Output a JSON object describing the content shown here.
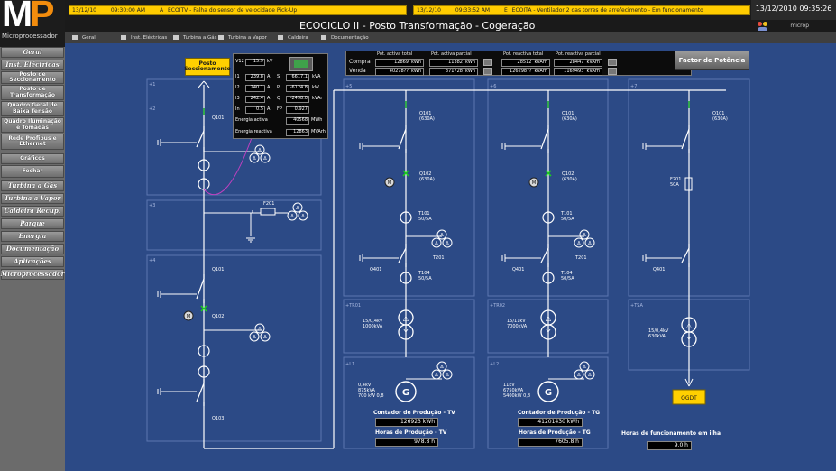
{
  "brand": {
    "logo_m": "M",
    "logo_p": "P",
    "logo_sub": "Microprocessador"
  },
  "alarms": [
    {
      "date": "13/12/10",
      "time": "09:30:00 AM",
      "state": "A",
      "text": "ECOITV - Falha do sensor de velocidade Pick-Up"
    },
    {
      "date": "13/12/10",
      "time": "09:33:52 AM",
      "state": "E",
      "text": "ECOITA - Ventilador 2 das torres de arrefecimento - Em funcionamento"
    }
  ],
  "datetime": "13/12/2010 09:35:26",
  "user": "microp",
  "title": "ECOCICLO II - Posto Transformação - Cogeração",
  "tabs": [
    "Geral",
    "Inst. Eléctricas",
    "Turbina a Gás",
    "Turbina a Vapor",
    "Caldeira",
    "Documentação"
  ],
  "sidebar": [
    {
      "label": "Geral",
      "style": "it"
    },
    {
      "label": "Inst. Eléctricas",
      "style": "it"
    },
    {
      "label": "Posto de Seccionamento",
      "style": ""
    },
    {
      "label": "Posto de Transformação",
      "style": ""
    },
    {
      "label": "Quadro Geral de Baixa Tensão",
      "style": ""
    },
    {
      "label": "Quadro Iluminação e Tomadas",
      "style": ""
    },
    {
      "label": "Rede Profibus e Ethernet",
      "style": ""
    },
    {
      "label": "Gráficos",
      "style": ""
    },
    {
      "label": "Fechar",
      "style": ""
    },
    {
      "label": "Turbina a Gás",
      "style": "it"
    },
    {
      "label": "Turbina a Vapor",
      "style": "it"
    },
    {
      "label": "Caldeira Recup.",
      "style": "it"
    },
    {
      "label": "Parque",
      "style": "it"
    },
    {
      "label": "Energia",
      "style": "it"
    },
    {
      "label": "Documentação",
      "style": "it"
    },
    {
      "label": "Aplicações",
      "style": "it"
    },
    {
      "label": "Microprocessador",
      "style": "it"
    }
  ],
  "posto_seccionamento": "Posto Seccionamento",
  "meter": {
    "rows": [
      {
        "l": "V12",
        "v": "15.9",
        "u": "kV"
      },
      {
        "l": "I1",
        "v": "239.8",
        "u": "A",
        "l2": "S",
        "v2": "6617.1",
        "u2": "kVA"
      },
      {
        "l": "I2",
        "v": "240.1",
        "u": "A",
        "l2": "P",
        "v2": "-6124.8",
        "u2": "kW"
      },
      {
        "l": "I3",
        "v": "242.4",
        "u": "A",
        "l2": "Q",
        "v2": "-2498.0",
        "u2": "kVAr"
      },
      {
        "l": "In",
        "v": "0.5",
        "u": "A",
        "l2": "FP",
        "v2": "0.927",
        "u2": ""
      }
    ],
    "active_label": "Energia activa",
    "active_value": "40568",
    "active_unit": "MWh",
    "reactive_label": "Energia reactiva",
    "reactive_value": "12863",
    "reactive_unit": "MVArh"
  },
  "energy": {
    "headers": [
      "Pot. activa total",
      "Pot. activa parcial",
      "Pot. reactiva total",
      "Pot. reactiva parcial"
    ],
    "rows": [
      {
        "label": "Compra",
        "values": [
          "12869",
          "11382",
          "28512",
          "28447"
        ]
      },
      {
        "label": "Venda",
        "values": [
          "40278??",
          "371728",
          "126298??",
          "1169493"
        ]
      }
    ],
    "units": [
      "kWh",
      "kWh",
      "kVArh",
      "kVArh"
    ]
  },
  "power_factor_button": "Factor de Potência",
  "panels": [
    "+1",
    "+2",
    "+3",
    "+4",
    "+5",
    "+6",
    "+7",
    "+TR01",
    "+TR02",
    "+TSA",
    "+L1",
    "+L2"
  ],
  "labels": {
    "q101": "Q101",
    "q102": "Q102",
    "q103": "Q103",
    "f201": "F201",
    "m": "M",
    "q101_630": "Q101\n(630A)",
    "q102_630": "Q102\n(630A)",
    "t101": "T101\n50/5A",
    "t201": "T201",
    "q401": "Q401",
    "t104": "T104\n50/5A",
    "tr01": "15/0,4kV\n1000kVA",
    "tr02": "15/11kV\n7000kVA",
    "tsa": "15/0,4kV\n630kVA",
    "g1": "0,4kV\n875kVA\n700 kW 0,8",
    "g2": "11kV\n6750kVA\n5400kW 0,8",
    "f201_50": "F201\n50A",
    "qgdt": "QGDT",
    "g": "G"
  },
  "counters": {
    "tv_prod_label": "Contador de Produção - TV",
    "tv_prod": "126923 kWh",
    "tv_hours_label": "Horas de Produção - TV",
    "tv_hours": "978.8 h",
    "tg_prod_label": "Contador de Produção - TG",
    "tg_prod": "41201430 kWh",
    "tg_hours_label": "Horas de Produção - TG",
    "tg_hours": "7605.8 h",
    "island_label": "Horas de funcionamento em ilha",
    "island": "9.0 h"
  },
  "colors": {
    "background": "#2c4a86",
    "bus": "#ffffff",
    "accent": "#ffd000",
    "breaker": "#1ad01a"
  }
}
